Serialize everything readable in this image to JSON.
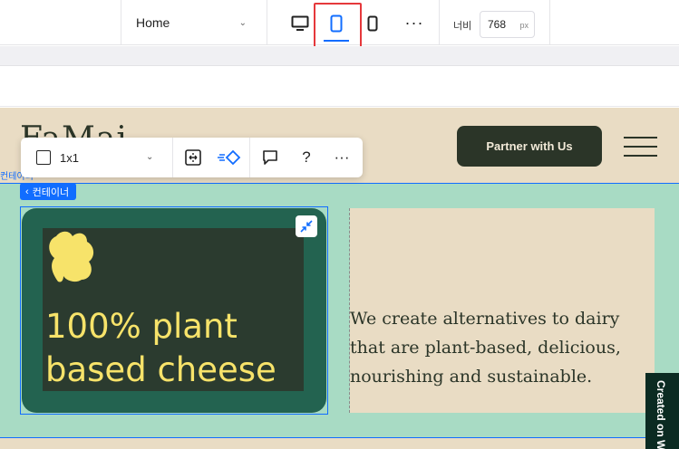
{
  "topbar": {
    "page_name": "Home",
    "width_label": "너비",
    "width_value": "768",
    "width_unit": "px",
    "more": "···"
  },
  "site": {
    "logo_text": "FaMai",
    "partner_button": "Partner with Us",
    "headline": "100% plant based cheese",
    "description": "We create alternatives to dairy that are plant-based, delicious, nourishing and sustainable.",
    "created_badge": "Created on Wix"
  },
  "element_toolbar": {
    "ratio_label": "1x1",
    "help": "?",
    "more": "···"
  },
  "selection": {
    "breadcrumb": "컨테이너",
    "ghost_label": "컨테이너"
  },
  "colors": {
    "accent": "#116dff",
    "highlight": "#e5383b",
    "site_bg": "#e9dcc4",
    "strip_bg": "#a8dbc4",
    "card_bg": "#236350",
    "headline": "#f7e36a",
    "dark_green": "#2b3528"
  },
  "icons": [
    "desktop-icon",
    "tablet-icon",
    "mobile-icon",
    "chevron-down-icon",
    "stretch-icon",
    "animation-icon",
    "comment-icon",
    "help-icon",
    "shrink-icon",
    "leaf-icon",
    "hamburger-icon"
  ]
}
